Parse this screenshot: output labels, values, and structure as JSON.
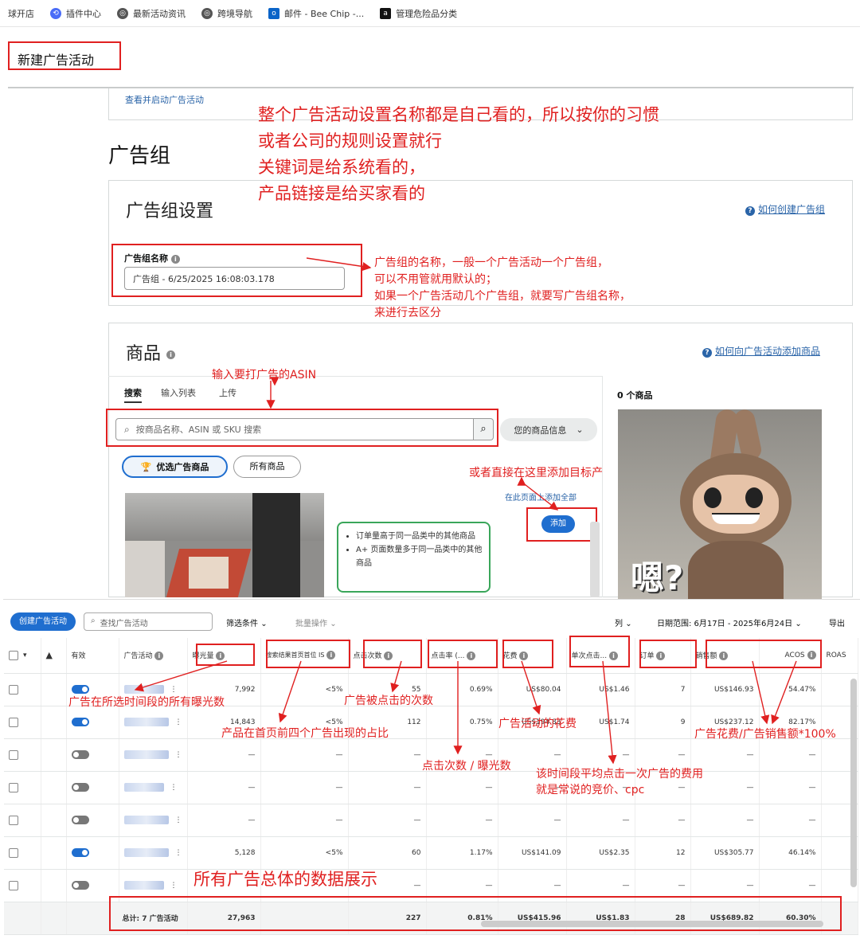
{
  "bookmarks": [
    {
      "label": "球开店",
      "icon": "none"
    },
    {
      "label": "插件中心",
      "icon": "plugin-icon"
    },
    {
      "label": "最新活动资讯",
      "icon": "globe-icon"
    },
    {
      "label": "跨境导航",
      "icon": "globe-icon"
    },
    {
      "label": "邮件 - Bee Chip -...",
      "icon": "outlook-icon"
    },
    {
      "label": "管理危险品分类",
      "icon": "amazon-icon"
    }
  ],
  "page_title": "新建广告活动",
  "view_link": "查看并启动广告活动",
  "section_title": "广告组",
  "group_settings": {
    "title": "广告组设置",
    "help_link": "如何创建广告组",
    "name_label": "广告组名称",
    "name_value": "广告组 - 6/25/2025 16:08:03.178"
  },
  "products": {
    "title": "商品",
    "help_link": "如何向广告活动添加商品",
    "tabs": [
      "搜索",
      "输入列表",
      "上传"
    ],
    "search_placeholder": "按商品名称、ASIN 或 SKU 搜索",
    "product_info_label": "您的商品信息",
    "filter_featured": "优选广告商品",
    "filter_all": "所有商品",
    "add_all_link": "在此页面上添加全部",
    "add_button": "添加",
    "bullets": [
      "订单量高于同一品类中的其他商品",
      "A+ 页面数量多于同一品类中的其他商品"
    ],
    "count_label": "0 个商品",
    "meme_text": "嗯?"
  },
  "annotations": {
    "top1": "整个广告活动设置名称都是自己看的，所以按你的习惯",
    "top2": "或者公司的规则设置就行",
    "top3": "关键词是给系统看的，",
    "top4": "产品链接是给买家看的",
    "group1": "广告组的名称，一般一个广告活动一个广告组，",
    "group2": "可以不用管就用默认的；",
    "group3": "如果一个广告活动几个广告组，就要写广告组名称，",
    "group4": "来进行去区分",
    "asin": "输入要打广告的ASIN",
    "direct_add": "或者直接在这里添加目标产",
    "impressions": "广告在所选时间段的所有曝光数",
    "top_share": "产品在首页前四个广告出现的占比",
    "clicks": "广告被点击的次数",
    "ctr": "点击次数 / 曝光数",
    "spend": "广告活动的花费",
    "cpc1": "该时间段平均点击一次广告的费用",
    "cpc2": "就是常说的竞价、cpc",
    "acos": "广告花费/广告销售额*100%",
    "total": "所有广告总体的数据展示"
  },
  "toolbar": {
    "create_button": "创建广告活动",
    "search_placeholder": "查找广告活动",
    "filter": "筛选条件",
    "bulk": "批量操作",
    "columns": "列",
    "date_range": "日期范围: 6月17日 - 2025年6月24日",
    "export": "导出"
  },
  "table": {
    "headers": [
      "有效",
      "广告活动",
      "曝光量",
      "搜索结果首页首位 IS",
      "点击次数",
      "点击率 (...",
      "花费",
      "单次点击...",
      "订单",
      "销售额",
      "ACOS",
      "ROAS"
    ],
    "rows": [
      {
        "active": true,
        "impressions": "7,992",
        "is": "<5%",
        "clicks": "55",
        "ctr": "0.69%",
        "spend": "US$80.04",
        "cpc": "US$1.46",
        "orders": "7",
        "sales": "US$146.93",
        "acos": "54.47%"
      },
      {
        "active": true,
        "impressions": "14,843",
        "is": "<5%",
        "clicks": "112",
        "ctr": "0.75%",
        "spend": "US$194.83",
        "cpc": "US$1.74",
        "orders": "9",
        "sales": "US$237.12",
        "acos": "82.17%"
      },
      {
        "active": false,
        "impressions": "—",
        "is": "—",
        "clicks": "—",
        "ctr": "—",
        "spend": "—",
        "cpc": "—",
        "orders": "—",
        "sales": "—",
        "acos": "—"
      },
      {
        "active": false,
        "impressions": "—",
        "is": "—",
        "clicks": "—",
        "ctr": "—",
        "spend": "—",
        "cpc": "—",
        "orders": "—",
        "sales": "—",
        "acos": "—"
      },
      {
        "active": false,
        "impressions": "—",
        "is": "—",
        "clicks": "—",
        "ctr": "—",
        "spend": "—",
        "cpc": "—",
        "orders": "—",
        "sales": "—",
        "acos": "—"
      },
      {
        "active": true,
        "impressions": "5,128",
        "is": "<5%",
        "clicks": "60",
        "ctr": "1.17%",
        "spend": "US$141.09",
        "cpc": "US$2.35",
        "orders": "12",
        "sales": "US$305.77",
        "acos": "46.14%"
      },
      {
        "active": false,
        "impressions": "—",
        "is": "—",
        "clicks": "—",
        "ctr": "—",
        "spend": "—",
        "cpc": "—",
        "orders": "—",
        "sales": "—",
        "acos": "—"
      }
    ],
    "total": {
      "label": "总计:  7 广告活动",
      "impressions": "27,963",
      "clicks": "227",
      "ctr": "0.81%",
      "spend": "US$415.96",
      "cpc": "US$1.83",
      "orders": "28",
      "sales": "US$689.82",
      "acos": "60.30%"
    }
  }
}
